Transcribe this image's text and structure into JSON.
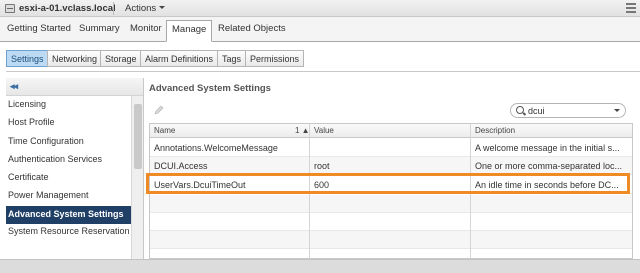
{
  "titlebar": {
    "host": "esxi-a-01.vclass.local",
    "actions": "Actions"
  },
  "main_tabs": [
    "Getting Started",
    "Summary",
    "Monitor",
    "Manage",
    "Related Objects"
  ],
  "sub_tabs": [
    "Settings",
    "Networking",
    "Storage",
    "Alarm Definitions",
    "Tags",
    "Permissions"
  ],
  "sidebar": {
    "collapse_glyph": "◂◂",
    "items": [
      "Licensing",
      "Host Profile",
      "Time Configuration",
      "Authentication Services",
      "Certificate",
      "Power Management",
      "Advanced System Settings",
      "System Resource Reservation"
    ]
  },
  "content": {
    "title": "Advanced System Settings",
    "search_value": "dcui",
    "columns": [
      "Name",
      "Value",
      "Description"
    ],
    "sort_glyph": "1 ▲",
    "rows": [
      {
        "name": "Annotations.WelcomeMessage",
        "value": "",
        "description": "A welcome message in the initial s..."
      },
      {
        "name": "DCUI.Access",
        "value": "root",
        "description": "One or more comma-separated loc..."
      },
      {
        "name": "UserVars.DcuiTimeOut",
        "value": "600",
        "description": "An idle time in seconds before DC..."
      }
    ]
  },
  "colors": {
    "highlight": "#f08a24",
    "selected_nav": "#1f3f66",
    "active_subtab": "#bcdaf3"
  }
}
